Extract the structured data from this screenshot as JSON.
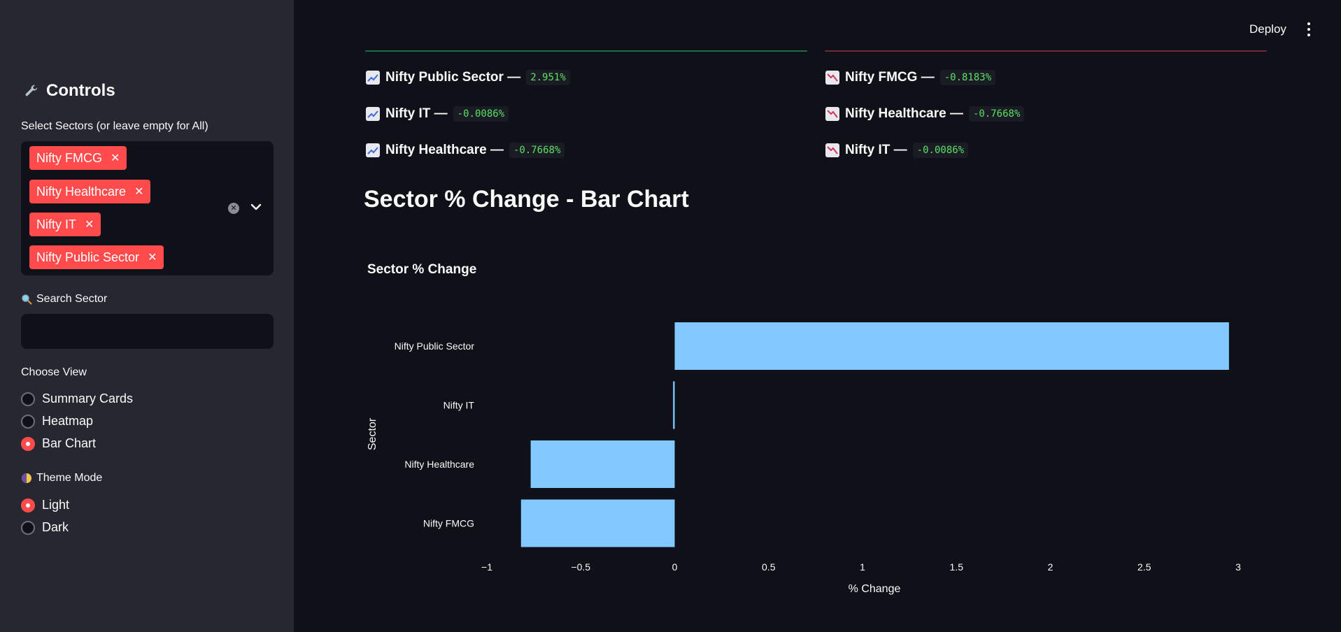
{
  "sidebar": {
    "title": "Controls",
    "sectors_label": "Select Sectors (or leave empty for All)",
    "selected_sectors": [
      {
        "label": "Nifty FMCG"
      },
      {
        "label": "Nifty Healthcare"
      },
      {
        "label": "Nifty IT"
      },
      {
        "label": "Nifty Public Sector"
      }
    ],
    "search_label": "Search Sector",
    "search_value": "",
    "view_label": "Choose View",
    "view_options": [
      {
        "label": "Summary Cards",
        "selected": false
      },
      {
        "label": "Heatmap",
        "selected": false
      },
      {
        "label": "Bar Chart",
        "selected": true
      }
    ],
    "theme_label": "Theme Mode",
    "theme_options": [
      {
        "label": "Light",
        "selected": true
      },
      {
        "label": "Dark",
        "selected": false
      }
    ]
  },
  "header": {
    "deploy_label": "Deploy"
  },
  "gainers": [
    {
      "name": "Nifty Public Sector —",
      "value": "2.951%"
    },
    {
      "name": "Nifty IT —",
      "value": "-0.0086%"
    },
    {
      "name": "Nifty Healthcare —",
      "value": "-0.7668%"
    }
  ],
  "losers": [
    {
      "name": "Nifty FMCG —",
      "value": "-0.8183%"
    },
    {
      "name": "Nifty Healthcare —",
      "value": "-0.7668%"
    },
    {
      "name": "Nifty IT —",
      "value": "-0.0086%"
    }
  ],
  "section_title": "Sector % Change - Bar Chart",
  "colors": {
    "accent": "#ff4b4b",
    "bar": "#83c9ff",
    "gain_line": "#2e7d4f",
    "loss_line": "#7a2f35",
    "code_text": "#5ce065"
  },
  "chart_data": {
    "type": "bar",
    "orientation": "horizontal",
    "title": "Sector % Change",
    "xlabel": "% Change",
    "ylabel": "Sector",
    "categories": [
      "Nifty Public Sector",
      "Nifty IT",
      "Nifty Healthcare",
      "Nifty FMCG"
    ],
    "values": [
      2.951,
      -0.0086,
      -0.7668,
      -0.8183
    ],
    "xlim": [
      -1,
      3
    ],
    "xticks": [
      -1,
      -0.5,
      0,
      0.5,
      1,
      1.5,
      2,
      2.5,
      3
    ],
    "xtick_labels": [
      "−1",
      "−0.5",
      "0",
      "0.5",
      "1",
      "1.5",
      "2",
      "2.5",
      "3"
    ],
    "grid": false
  }
}
